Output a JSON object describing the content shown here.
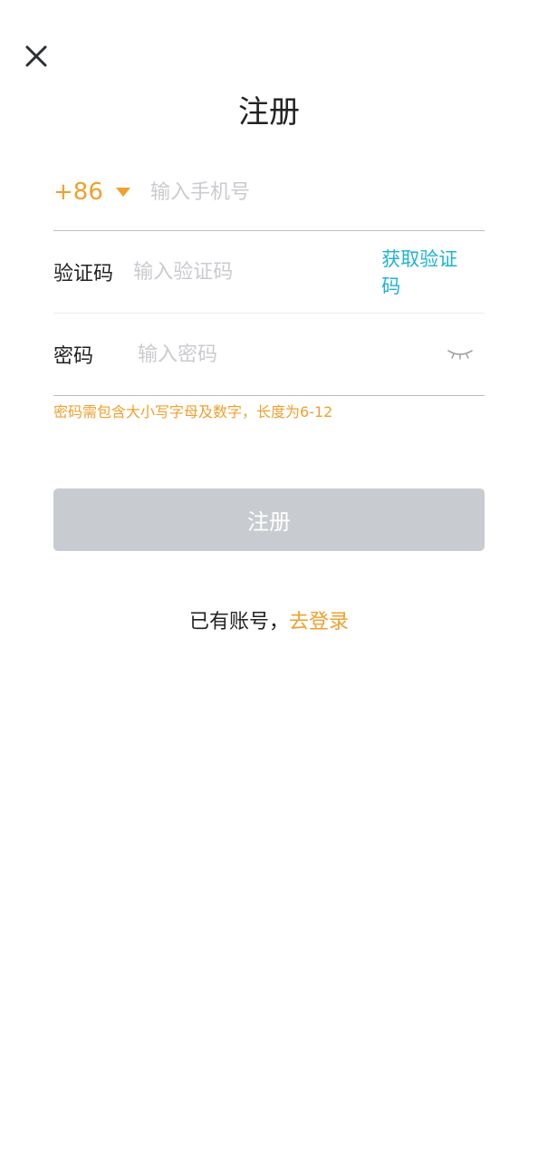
{
  "page": {
    "title": "注册"
  },
  "icons": {
    "close": "close-icon",
    "dropdown": "caret-down-icon",
    "password_toggle": "eye-closed-icon"
  },
  "phone": {
    "country_code": "+86",
    "placeholder": "输入手机号"
  },
  "code": {
    "label": "验证码",
    "placeholder": "输入验证码",
    "get_code_label": "获取验证码"
  },
  "password": {
    "label": "密码",
    "placeholder": "输入密码",
    "hint": "密码需包含大小写字母及数字，长度为6-12"
  },
  "register_button": {
    "label": "注册"
  },
  "login": {
    "prompt": "已有账号，",
    "link": "去登录"
  },
  "colors": {
    "accent": "#f0a02e",
    "link_blue": "#1fb1d4",
    "button_disabled": "#c8cbcf",
    "text": "#222222",
    "placeholder": "#c9cbd0"
  }
}
